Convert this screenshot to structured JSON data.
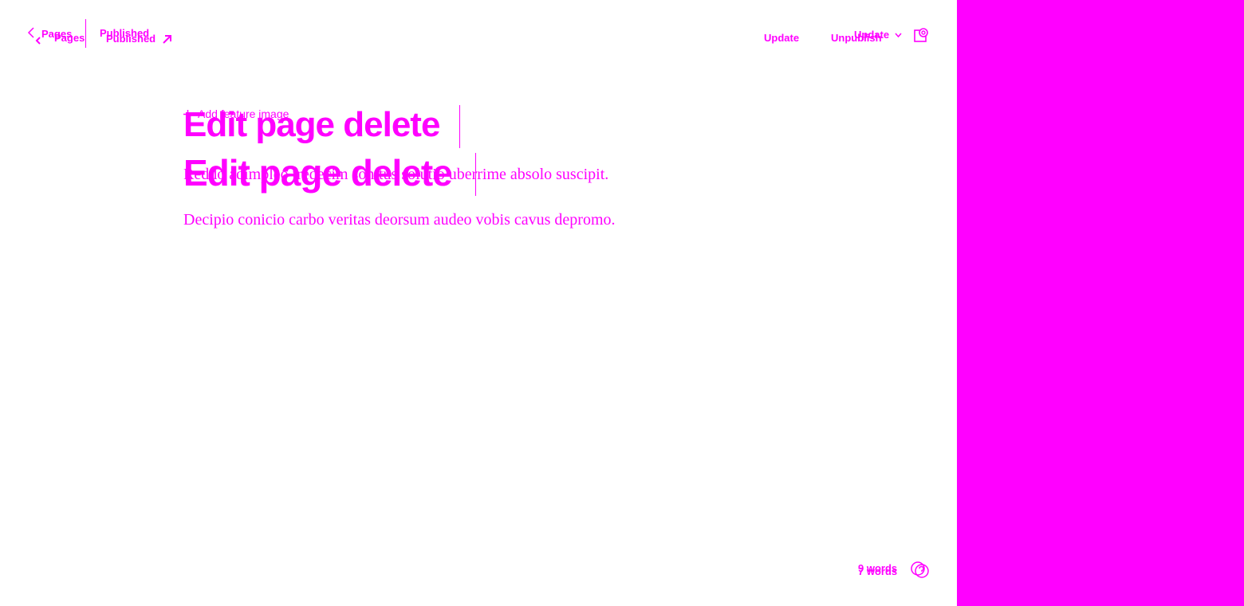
{
  "accent_color": "#ff00ff",
  "background_color": "#ffffff",
  "header_ghost": {
    "back_label": "Pages",
    "status_label": "Published"
  },
  "header": {
    "back_label": "Pages",
    "status_label": "Published",
    "update_label": "Update",
    "unpublish_label": "Unpublish",
    "update_dropdown_label": "Update"
  },
  "editor": {
    "feature_image_label": "Add feature image",
    "title_ghost": "Edit page delete",
    "title": "Edit page delete",
    "paragraph_ghost": "Reddo adimpleo tredecim sonitus solutio uberrime absolo suscipit.",
    "paragraph": "Decipio conicio carbo veritas deorsum audeo vobis cavus depromo."
  },
  "footer": {
    "word_count_ghost": "9 words",
    "word_count": "7 words"
  },
  "icons": {
    "back": "chevron-left-icon",
    "external": "arrow-up-right-icon",
    "dropdown": "chevron-down-icon",
    "settings": "settings-panel-icon",
    "help": "help-circle-icon",
    "add": "plus-icon"
  }
}
